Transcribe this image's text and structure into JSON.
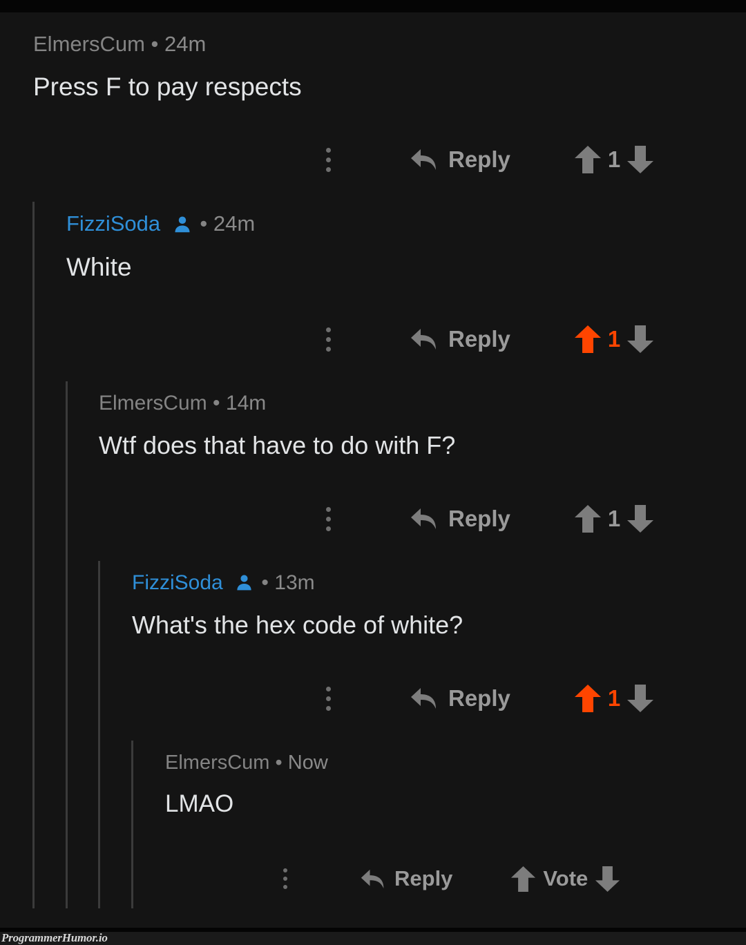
{
  "meta": {
    "platform_style": "reddit-dark-comment-thread",
    "watermark": "ProgrammerHumor.io",
    "colors": {
      "background": "#141414",
      "black_band": "#050505",
      "text": "#e2e4e6",
      "muted_text": "#848484",
      "op_username": "#2f8fd8",
      "upvoted": "#ff4500",
      "arrow_gray": "#6e6e6e",
      "thread_line": "#3b3b3b"
    }
  },
  "labels": {
    "reply": "Reply",
    "vote": "Vote",
    "separator": "•",
    "kebab_icon": "more-options-icon",
    "reply_icon": "reply-arrow-icon",
    "upvote_icon": "upvote-arrow-icon",
    "downvote_icon": "downvote-arrow-icon",
    "op_badge_icon": "op-person-icon"
  },
  "comments": [
    {
      "id": "c1",
      "depth": 0,
      "author": "ElmersCum",
      "is_op": false,
      "timestamp": "24m",
      "text": "Press F to pay respects",
      "vote_count": "1",
      "upvoted": false,
      "downvoted": false
    },
    {
      "id": "c2",
      "depth": 1,
      "author": "FizziSoda",
      "is_op": true,
      "timestamp": "24m",
      "text": "White",
      "vote_count": "1",
      "upvoted": true,
      "downvoted": false
    },
    {
      "id": "c3",
      "depth": 2,
      "author": "ElmersCum",
      "is_op": false,
      "timestamp": "14m",
      "text": "Wtf does that have to do with F?",
      "vote_count": "1",
      "upvoted": false,
      "downvoted": false
    },
    {
      "id": "c4",
      "depth": 3,
      "author": "FizziSoda",
      "is_op": true,
      "timestamp": "13m",
      "text": "What's the hex code of white?",
      "vote_count": "1",
      "upvoted": true,
      "downvoted": false
    },
    {
      "id": "c5",
      "depth": 4,
      "author": "ElmersCum",
      "is_op": false,
      "timestamp": "Now",
      "text": "LMAO",
      "vote_count": "Vote",
      "upvoted": false,
      "downvoted": false
    }
  ]
}
